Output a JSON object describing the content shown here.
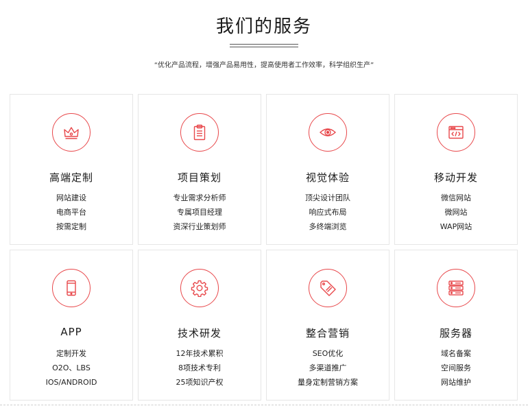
{
  "header": {
    "title": "我们的服务",
    "subtitle": "“优化产品流程，增强产品易用性，提高使用者工作效率，科学组织生产”"
  },
  "accent_color": "#e8474a",
  "cards": [
    {
      "icon": "crown-icon",
      "title": "高端定制",
      "items": [
        "网站建设",
        "电商平台",
        "按需定制"
      ]
    },
    {
      "icon": "clipboard-icon",
      "title": "项目策划",
      "items": [
        "专业需求分析师",
        "专属项目经理",
        "资深行业策划师"
      ]
    },
    {
      "icon": "eye-icon",
      "title": "视觉体验",
      "items": [
        "顶尖设计团队",
        "响应式布局",
        "多终端浏览"
      ]
    },
    {
      "icon": "code-window-icon",
      "title": "移动开发",
      "items": [
        "微信网站",
        "微网站",
        "WAP网站"
      ]
    },
    {
      "icon": "mobile-phone-icon",
      "title": "APP",
      "items": [
        "定制开发",
        "O2O、LBS",
        "IOS/ANDROID"
      ]
    },
    {
      "icon": "gear-icon",
      "title": "技术研发",
      "items": [
        "12年技术累积",
        "8项技术专利",
        "25项知识产权"
      ]
    },
    {
      "icon": "sale-tag-icon",
      "title": "整合营销",
      "items": [
        "SEO优化",
        "多渠道推广",
        "量身定制营销方案"
      ]
    },
    {
      "icon": "server-icon",
      "title": "服务器",
      "items": [
        "域名备案",
        "空间服务",
        "网站维护"
      ]
    }
  ]
}
